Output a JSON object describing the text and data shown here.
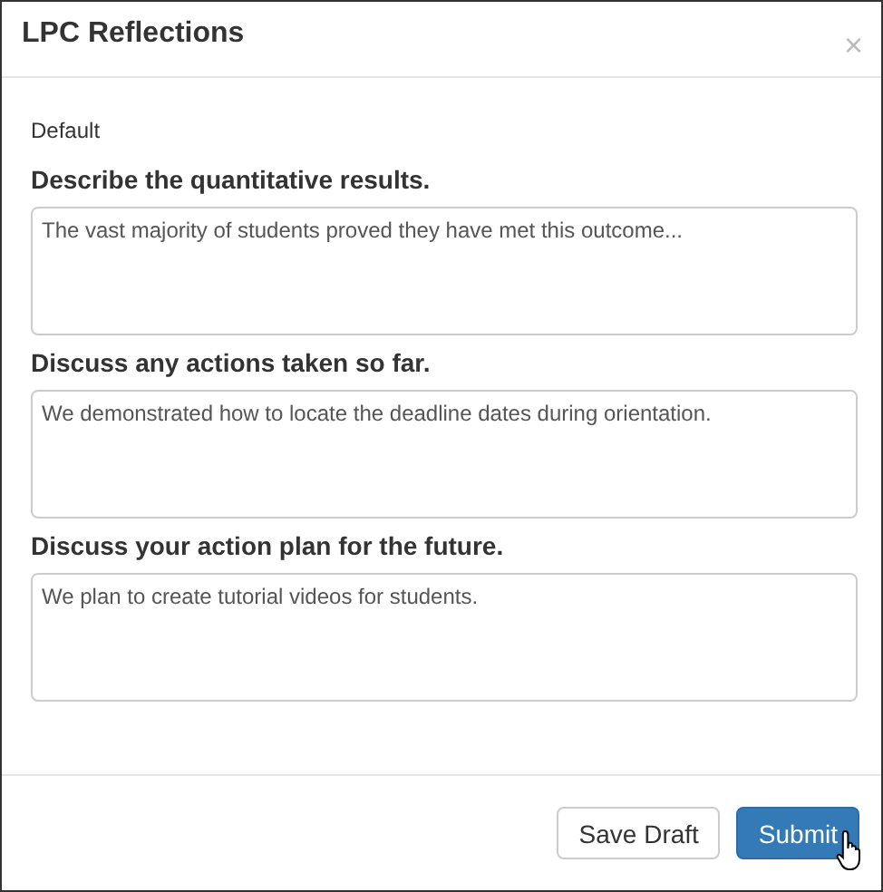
{
  "window": {
    "title": "LPC Reflections",
    "close": "×"
  },
  "template_label": "Default",
  "questions": [
    {
      "label": "Describe the quantitative results.",
      "value": "The vast majority of students proved they have met this outcome..."
    },
    {
      "label": "Discuss any actions taken so far.",
      "value": "We demonstrated how to locate the deadline dates during orientation."
    },
    {
      "label": "Discuss your action plan for the future.",
      "value": "We plan to create tutorial videos for students."
    }
  ],
  "buttons": [
    {
      "label": "Save Draft",
      "kind": "default"
    },
    {
      "label": "Submit",
      "kind": "primary"
    }
  ]
}
